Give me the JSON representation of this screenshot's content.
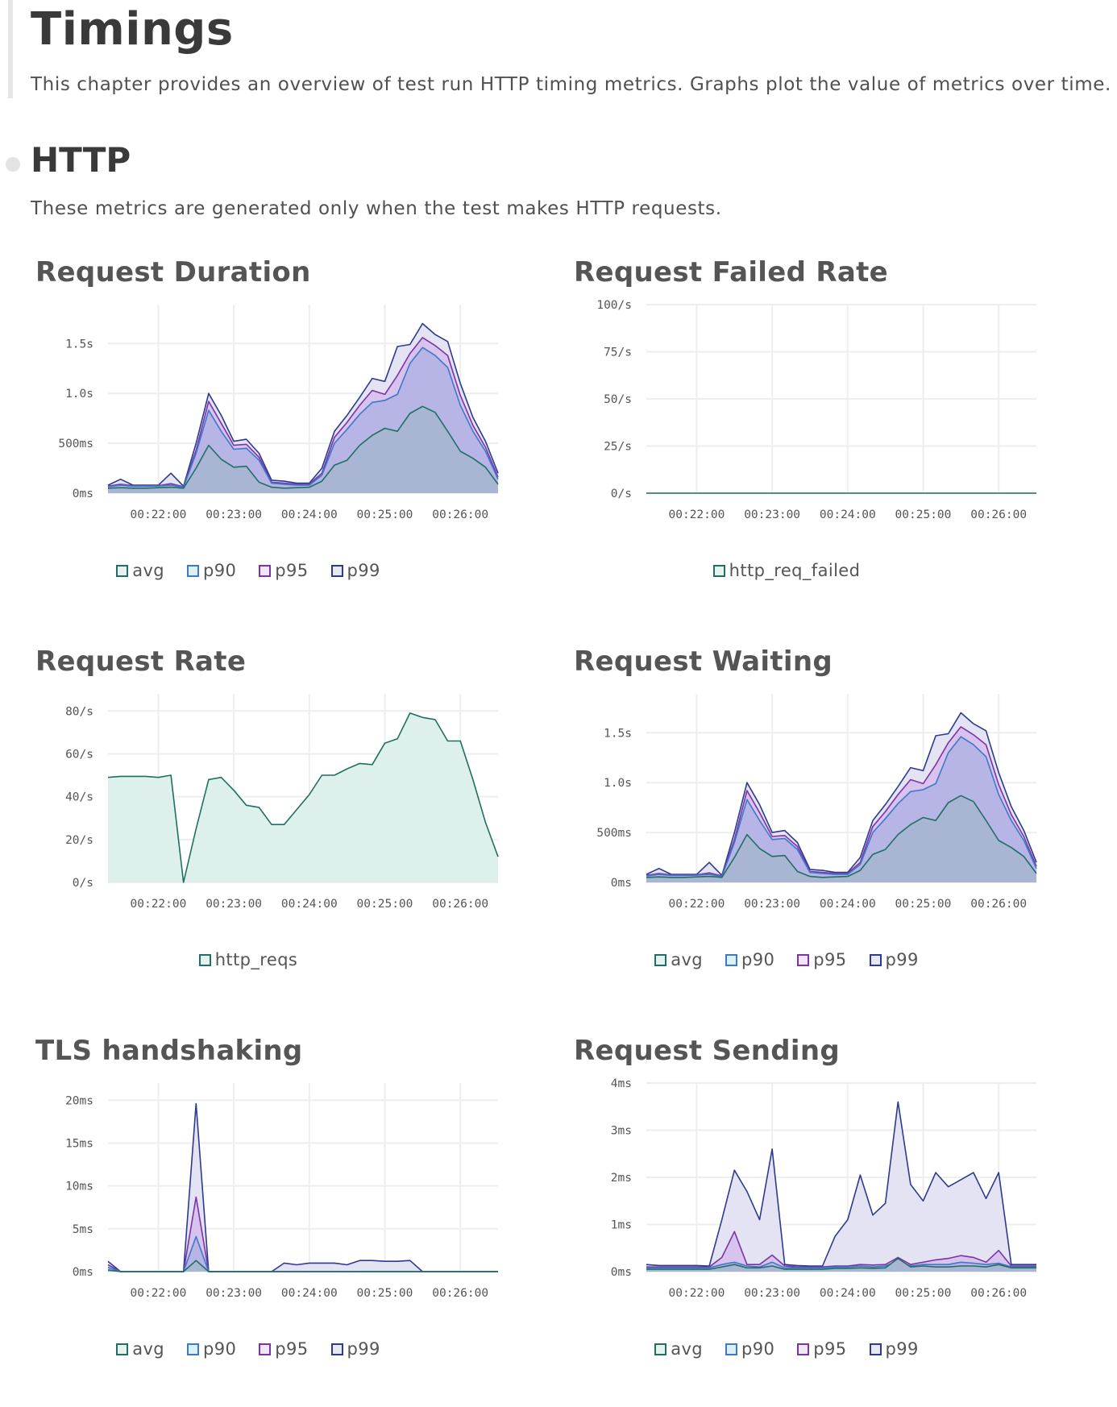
{
  "page": {
    "title": "Timings",
    "description": "This chapter provides an overview of test run HTTP timing metrics. Graphs plot the value of metrics over time."
  },
  "section": {
    "title": "HTTP",
    "description": "These metrics are generated only when the test makes HTTP requests."
  },
  "series_colors": {
    "avg": "#1f6f62",
    "p90": "#3f78c8",
    "p95": "#7a34a6",
    "p99": "#2d3a8e",
    "http_req_failed": "#1f6f62",
    "http_reqs": "#1f6f62"
  },
  "fill_colors": {
    "avg": "#a9b6d3",
    "p90": "#b7b4e6",
    "p95": "#d8c3ee",
    "p99": "#e4e3f3",
    "http_req_failed": "#def0ec",
    "http_reqs": "#def0ec"
  },
  "legend_fill_colors": {
    "avg": "#e6f2ee",
    "p90": "#d9f1fb",
    "p95": "#f1e6f7",
    "p99": "#e7e8f5",
    "http_req_failed": "#e6f2ee",
    "http_reqs": "#e6f2ee"
  },
  "chart_data": [
    {
      "id": "request-duration",
      "type": "area",
      "title": "Request Duration",
      "x": [
        "00:21:20",
        "00:21:30",
        "00:21:40",
        "00:21:50",
        "00:22:00",
        "00:22:10",
        "00:22:20",
        "00:22:30",
        "00:22:40",
        "00:22:50",
        "00:23:00",
        "00:23:10",
        "00:23:20",
        "00:23:30",
        "00:23:40",
        "00:23:50",
        "00:24:00",
        "00:24:10",
        "00:24:20",
        "00:24:30",
        "00:24:40",
        "00:24:50",
        "00:25:00",
        "00:25:10",
        "00:25:20",
        "00:25:30",
        "00:25:40",
        "00:25:50",
        "00:26:00",
        "00:26:10",
        "00:26:20",
        "00:26:30"
      ],
      "xticks": [
        "00:22:00",
        "00:23:00",
        "00:24:00",
        "00:25:00",
        "00:26:00"
      ],
      "yticks": [
        {
          "v": 0,
          "label": "0ms"
        },
        {
          "v": 500,
          "label": "500ms"
        },
        {
          "v": 1000,
          "label": "1.0s"
        },
        {
          "v": 1500,
          "label": "1.5s"
        }
      ],
      "ylim": [
        0,
        1890
      ],
      "grid": true,
      "legend": "bottom-center",
      "series": [
        {
          "name": "p99",
          "values": [
            80,
            140,
            80,
            80,
            80,
            200,
            70,
            500,
            1000,
            780,
            520,
            540,
            400,
            130,
            120,
            100,
            100,
            250,
            620,
            780,
            960,
            1150,
            1120,
            1470,
            1490,
            1700,
            1590,
            1520,
            1100,
            760,
            520,
            200
          ]
        },
        {
          "name": "p95",
          "values": [
            70,
            90,
            75,
            75,
            75,
            95,
            65,
            430,
            920,
            700,
            480,
            490,
            360,
            110,
            100,
            90,
            90,
            200,
            560,
            710,
            880,
            1030,
            990,
            1180,
            1400,
            1560,
            1480,
            1380,
            980,
            680,
            460,
            160
          ]
        },
        {
          "name": "p90",
          "values": [
            65,
            80,
            70,
            70,
            72,
            80,
            60,
            400,
            830,
            620,
            440,
            450,
            330,
            100,
            90,
            80,
            80,
            180,
            500,
            640,
            790,
            910,
            930,
            990,
            1300,
            1460,
            1380,
            1260,
            880,
            620,
            420,
            140
          ]
        },
        {
          "name": "avg",
          "values": [
            50,
            55,
            50,
            50,
            55,
            60,
            50,
            250,
            480,
            340,
            260,
            270,
            110,
            60,
            50,
            55,
            60,
            120,
            280,
            330,
            480,
            580,
            650,
            620,
            800,
            870,
            810,
            620,
            420,
            350,
            260,
            90
          ]
        }
      ]
    },
    {
      "id": "request-failed-rate",
      "type": "line",
      "title": "Request Failed Rate",
      "x": [
        "00:21:20",
        "00:21:30",
        "00:21:40",
        "00:21:50",
        "00:22:00",
        "00:22:10",
        "00:22:20",
        "00:22:30",
        "00:22:40",
        "00:22:50",
        "00:23:00",
        "00:23:10",
        "00:23:20",
        "00:23:30",
        "00:23:40",
        "00:23:50",
        "00:24:00",
        "00:24:10",
        "00:24:20",
        "00:24:30",
        "00:24:40",
        "00:24:50",
        "00:25:00",
        "00:25:10",
        "00:25:20",
        "00:25:30",
        "00:25:40",
        "00:25:50",
        "00:26:00",
        "00:26:10",
        "00:26:20",
        "00:26:30"
      ],
      "xticks": [
        "00:22:00",
        "00:23:00",
        "00:24:00",
        "00:25:00",
        "00:26:00"
      ],
      "yticks": [
        {
          "v": 0,
          "label": "0/s"
        },
        {
          "v": 25,
          "label": "25/s"
        },
        {
          "v": 50,
          "label": "50/s"
        },
        {
          "v": 75,
          "label": "75/s"
        },
        {
          "v": 100,
          "label": "100/s"
        }
      ],
      "ylim": [
        0,
        100
      ],
      "grid": true,
      "legend": "bottom-center",
      "series": [
        {
          "name": "http_req_failed",
          "values": [
            0,
            0,
            0,
            0,
            0,
            0,
            0,
            0,
            0,
            0,
            0,
            0,
            0,
            0,
            0,
            0,
            0,
            0,
            0,
            0,
            0,
            0,
            0,
            0,
            0,
            0,
            0,
            0,
            0,
            0,
            0,
            0
          ]
        }
      ]
    },
    {
      "id": "request-rate",
      "type": "area",
      "title": "Request Rate",
      "x": [
        "00:21:20",
        "00:21:30",
        "00:21:40",
        "00:21:50",
        "00:22:00",
        "00:22:10",
        "00:22:20",
        "00:22:30",
        "00:22:40",
        "00:22:50",
        "00:23:00",
        "00:23:10",
        "00:23:20",
        "00:23:30",
        "00:23:40",
        "00:23:50",
        "00:24:00",
        "00:24:10",
        "00:24:20",
        "00:24:30",
        "00:24:40",
        "00:24:50",
        "00:25:00",
        "00:25:10",
        "00:25:20",
        "00:25:30",
        "00:25:40",
        "00:25:50",
        "00:26:00",
        "00:26:10",
        "00:26:20",
        "00:26:30"
      ],
      "xticks": [
        "00:22:00",
        "00:23:00",
        "00:24:00",
        "00:25:00",
        "00:26:00"
      ],
      "yticks": [
        {
          "v": 0,
          "label": "0/s"
        },
        {
          "v": 20,
          "label": "20/s"
        },
        {
          "v": 40,
          "label": "40/s"
        },
        {
          "v": 60,
          "label": "60/s"
        },
        {
          "v": 80,
          "label": "80/s"
        }
      ],
      "ylim": [
        0,
        88
      ],
      "grid": true,
      "legend": "bottom-center",
      "series": [
        {
          "name": "http_reqs",
          "values": [
            49,
            49.5,
            49.5,
            49.5,
            49,
            50,
            0,
            25,
            48,
            49,
            43,
            36,
            35,
            27,
            27,
            34,
            41,
            50,
            50,
            53,
            55.5,
            55,
            65,
            67,
            79,
            77,
            76,
            66,
            66,
            48,
            28,
            12
          ]
        }
      ]
    },
    {
      "id": "request-waiting",
      "type": "area",
      "title": "Request Waiting",
      "x": [
        "00:21:20",
        "00:21:30",
        "00:21:40",
        "00:21:50",
        "00:22:00",
        "00:22:10",
        "00:22:20",
        "00:22:30",
        "00:22:40",
        "00:22:50",
        "00:23:00",
        "00:23:10",
        "00:23:20",
        "00:23:30",
        "00:23:40",
        "00:23:50",
        "00:24:00",
        "00:24:10",
        "00:24:20",
        "00:24:30",
        "00:24:40",
        "00:24:50",
        "00:25:00",
        "00:25:10",
        "00:25:20",
        "00:25:30",
        "00:25:40",
        "00:25:50",
        "00:26:00",
        "00:26:10",
        "00:26:20",
        "00:26:30"
      ],
      "xticks": [
        "00:22:00",
        "00:23:00",
        "00:24:00",
        "00:25:00",
        "00:26:00"
      ],
      "yticks": [
        {
          "v": 0,
          "label": "0ms"
        },
        {
          "v": 500,
          "label": "500ms"
        },
        {
          "v": 1000,
          "label": "1.0s"
        },
        {
          "v": 1500,
          "label": "1.5s"
        }
      ],
      "ylim": [
        0,
        1890
      ],
      "grid": true,
      "legend": "bottom-center",
      "series": [
        {
          "name": "p99",
          "values": [
            80,
            140,
            80,
            80,
            80,
            200,
            70,
            500,
            1000,
            780,
            500,
            520,
            400,
            130,
            120,
            100,
            100,
            250,
            620,
            780,
            960,
            1150,
            1120,
            1470,
            1490,
            1700,
            1590,
            1520,
            1100,
            760,
            520,
            200
          ]
        },
        {
          "name": "p95",
          "values": [
            70,
            90,
            75,
            75,
            75,
            95,
            65,
            430,
            920,
            700,
            460,
            470,
            360,
            110,
            100,
            90,
            90,
            200,
            560,
            710,
            880,
            1030,
            990,
            1180,
            1400,
            1560,
            1480,
            1380,
            980,
            680,
            460,
            160
          ]
        },
        {
          "name": "p90",
          "values": [
            65,
            80,
            70,
            70,
            72,
            80,
            60,
            400,
            830,
            620,
            430,
            440,
            330,
            100,
            90,
            80,
            80,
            180,
            500,
            640,
            790,
            910,
            930,
            990,
            1300,
            1460,
            1380,
            1260,
            880,
            620,
            420,
            140
          ]
        },
        {
          "name": "avg",
          "values": [
            50,
            55,
            50,
            50,
            55,
            60,
            50,
            250,
            480,
            340,
            260,
            270,
            110,
            60,
            50,
            55,
            60,
            120,
            280,
            330,
            480,
            580,
            650,
            620,
            800,
            870,
            810,
            620,
            420,
            350,
            260,
            90
          ]
        }
      ]
    },
    {
      "id": "tls-handshaking",
      "type": "area",
      "title": "TLS handshaking",
      "x": [
        "00:21:20",
        "00:21:30",
        "00:21:40",
        "00:21:50",
        "00:22:00",
        "00:22:10",
        "00:22:20",
        "00:22:30",
        "00:22:40",
        "00:22:50",
        "00:23:00",
        "00:23:10",
        "00:23:20",
        "00:23:30",
        "00:23:40",
        "00:23:50",
        "00:24:00",
        "00:24:10",
        "00:24:20",
        "00:24:30",
        "00:24:40",
        "00:24:50",
        "00:25:00",
        "00:25:10",
        "00:25:20",
        "00:25:30",
        "00:25:40",
        "00:25:50",
        "00:26:00",
        "00:26:10",
        "00:26:20",
        "00:26:30"
      ],
      "xticks": [
        "00:22:00",
        "00:23:00",
        "00:24:00",
        "00:25:00",
        "00:26:00"
      ],
      "yticks": [
        {
          "v": 0,
          "label": "0ms"
        },
        {
          "v": 5,
          "label": "5ms"
        },
        {
          "v": 10,
          "label": "10ms"
        },
        {
          "v": 15,
          "label": "15ms"
        },
        {
          "v": 20,
          "label": "20ms"
        }
      ],
      "ylim": [
        0,
        22
      ],
      "grid": true,
      "legend": "bottom-center",
      "series": [
        {
          "name": "p99",
          "values": [
            1.2,
            0,
            0,
            0,
            0,
            0,
            0,
            19.6,
            0,
            0,
            0,
            0,
            0,
            0,
            1,
            0.8,
            1,
            1,
            1,
            0.8,
            1.3,
            1.3,
            1.2,
            1.2,
            1.3,
            0,
            0,
            0,
            0,
            0,
            0,
            0
          ]
        },
        {
          "name": "p95",
          "values": [
            0.8,
            0,
            0,
            0,
            0,
            0,
            0,
            8.7,
            0,
            0,
            0,
            0,
            0,
            0,
            0,
            0,
            0,
            0,
            0,
            0,
            0,
            0,
            0,
            0,
            0,
            0,
            0,
            0,
            0,
            0,
            0,
            0
          ]
        },
        {
          "name": "p90",
          "values": [
            0.5,
            0,
            0,
            0,
            0,
            0,
            0,
            4.1,
            0,
            0,
            0,
            0,
            0,
            0,
            0,
            0,
            0,
            0,
            0,
            0,
            0,
            0,
            0,
            0,
            0,
            0,
            0,
            0,
            0,
            0,
            0,
            0
          ]
        },
        {
          "name": "avg",
          "values": [
            0.2,
            0,
            0,
            0,
            0,
            0,
            0,
            1.3,
            0,
            0,
            0,
            0,
            0,
            0,
            0,
            0,
            0,
            0,
            0,
            0,
            0,
            0,
            0,
            0,
            0,
            0,
            0,
            0,
            0,
            0,
            0,
            0
          ]
        }
      ]
    },
    {
      "id": "request-sending",
      "type": "area",
      "title": "Request Sending",
      "x": [
        "00:21:20",
        "00:21:30",
        "00:21:40",
        "00:21:50",
        "00:22:00",
        "00:22:10",
        "00:22:20",
        "00:22:30",
        "00:22:40",
        "00:22:50",
        "00:23:00",
        "00:23:10",
        "00:23:20",
        "00:23:30",
        "00:23:40",
        "00:23:50",
        "00:24:00",
        "00:24:10",
        "00:24:20",
        "00:24:30",
        "00:24:40",
        "00:24:50",
        "00:25:00",
        "00:25:10",
        "00:25:20",
        "00:25:30",
        "00:25:40",
        "00:25:50",
        "00:26:00",
        "00:26:10",
        "00:26:20",
        "00:26:30"
      ],
      "xticks": [
        "00:22:00",
        "00:23:00",
        "00:24:00",
        "00:25:00",
        "00:26:00"
      ],
      "yticks": [
        {
          "v": 0,
          "label": "0ms"
        },
        {
          "v": 1,
          "label": "1ms"
        },
        {
          "v": 2,
          "label": "2ms"
        },
        {
          "v": 3,
          "label": "3ms"
        },
        {
          "v": 4,
          "label": "4ms"
        }
      ],
      "ylim": [
        0,
        4
      ],
      "grid": true,
      "legend": "bottom-center",
      "series": [
        {
          "name": "p99",
          "values": [
            0.15,
            0.13,
            0.13,
            0.13,
            0.13,
            0.12,
            1.1,
            2.15,
            1.7,
            1.1,
            2.6,
            0.15,
            0.13,
            0.12,
            0.12,
            0.75,
            1.1,
            2.05,
            1.2,
            1.45,
            3.6,
            1.85,
            1.5,
            2.1,
            1.8,
            1.95,
            2.1,
            1.55,
            2.1,
            0.15,
            0.15,
            0.15
          ]
        },
        {
          "name": "p95",
          "values": [
            0.1,
            0.1,
            0.1,
            0.1,
            0.1,
            0.1,
            0.3,
            0.85,
            0.15,
            0.15,
            0.35,
            0.12,
            0.1,
            0.1,
            0.1,
            0.12,
            0.12,
            0.15,
            0.14,
            0.15,
            0.3,
            0.15,
            0.2,
            0.25,
            0.28,
            0.34,
            0.3,
            0.2,
            0.45,
            0.12,
            0.12,
            0.12
          ]
        },
        {
          "name": "p90",
          "values": [
            0.08,
            0.08,
            0.08,
            0.08,
            0.08,
            0.08,
            0.15,
            0.2,
            0.12,
            0.1,
            0.2,
            0.08,
            0.08,
            0.08,
            0.08,
            0.1,
            0.1,
            0.12,
            0.1,
            0.12,
            0.22,
            0.12,
            0.15,
            0.15,
            0.15,
            0.2,
            0.18,
            0.15,
            0.18,
            0.1,
            0.1,
            0.1
          ]
        },
        {
          "name": "avg",
          "values": [
            0.05,
            0.05,
            0.05,
            0.05,
            0.05,
            0.05,
            0.1,
            0.15,
            0.08,
            0.08,
            0.12,
            0.05,
            0.05,
            0.05,
            0.05,
            0.07,
            0.07,
            0.08,
            0.07,
            0.08,
            0.28,
            0.1,
            0.12,
            0.1,
            0.1,
            0.12,
            0.12,
            0.1,
            0.15,
            0.08,
            0.08,
            0.08
          ]
        }
      ]
    }
  ]
}
